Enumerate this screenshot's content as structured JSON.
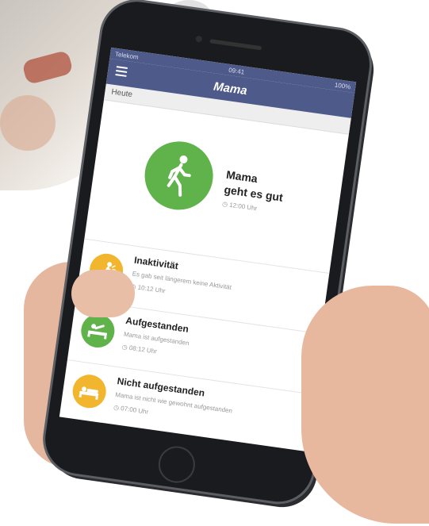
{
  "status_bar": {
    "carrier": "Telekom",
    "time": "09:41",
    "battery": "100%"
  },
  "nav": {
    "title": "Mama"
  },
  "section": {
    "heading": "Heute"
  },
  "hero": {
    "line1": "Mama",
    "line2": "geht es gut",
    "time": "12:00 Uhr",
    "icon": "walking-person-icon",
    "color": "#5fb34a"
  },
  "events": [
    {
      "title": "Inaktivität",
      "description": "Es gab seit längerem keine Aktivität",
      "time": "10:12 Uhr",
      "icon": "inactive-person-icon",
      "color": "#f2b52e"
    },
    {
      "title": "Aufgestanden",
      "description": "Mama ist aufgestanden",
      "time": "08:12 Uhr",
      "icon": "bed-rising-icon",
      "color": "#5fb34a"
    },
    {
      "title": "Nicht aufgestanden",
      "description": "Mama ist nicht wie gewohnt aufgestanden",
      "time": "07:00 Uhr",
      "icon": "bed-icon",
      "color": "#f2b52e"
    }
  ]
}
